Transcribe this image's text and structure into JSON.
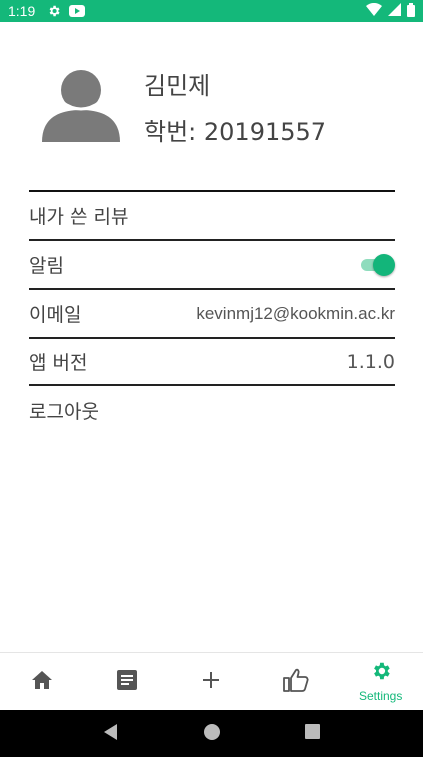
{
  "status_bar": {
    "time": "1:19"
  },
  "profile": {
    "name": "김민제",
    "student_id_label": "학번:",
    "student_id": "20191557"
  },
  "menu": {
    "my_reviews": "내가 쓴 리뷰",
    "notifications": "알림",
    "notifications_enabled": true,
    "email_label": "이메일",
    "email_value": "kevinmj12@kookmin.ac.kr",
    "version_label": "앱 버전",
    "version_value": "1.1.0",
    "logout": "로그아웃"
  },
  "bottom_nav": {
    "items": [
      {
        "icon": "home-icon"
      },
      {
        "icon": "document-icon"
      },
      {
        "icon": "plus-icon"
      },
      {
        "icon": "thumbs-up-icon"
      },
      {
        "icon": "gear-icon",
        "label": "Settings",
        "active": true
      }
    ]
  },
  "colors": {
    "accent": "#14b87a",
    "toggle_track": "#8fdcbd",
    "system_nav": "#000000"
  }
}
